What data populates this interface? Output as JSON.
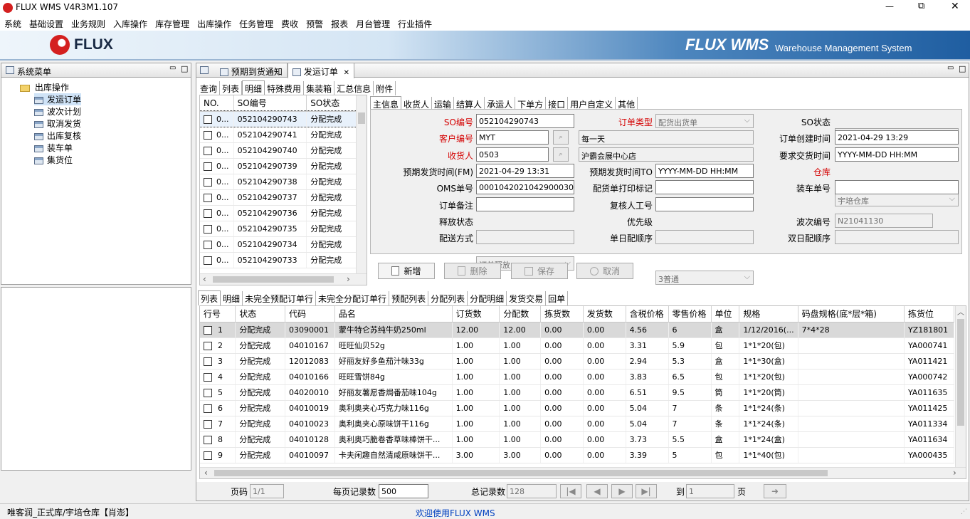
{
  "window": {
    "title": "FLUX WMS V4R3M1.107",
    "controls": [
      "—",
      "⧉",
      "✕"
    ]
  },
  "menu": [
    "系统",
    "基础设置",
    "业务规则",
    "入库操作",
    "库存管理",
    "出库操作",
    "任务管理",
    "费收",
    "预警",
    "报表",
    "月台管理",
    "行业插件"
  ],
  "banner": {
    "logo": "FLUX",
    "right_title": "FLUX WMS",
    "right_sub": "Warehouse Management System"
  },
  "sidebar": {
    "title": "系统菜单",
    "root": "出库操作",
    "items": [
      "发运订单",
      "波次计划",
      "取消发货",
      "出库复核",
      "装车单",
      "集货位"
    ],
    "selected": 0
  },
  "editor_tabs": [
    "预期到货通知",
    "发运订单"
  ],
  "sub_tabs": [
    "查询",
    "列表",
    "明细",
    "特殊费用",
    "集装箱",
    "汇总信息",
    "附件"
  ],
  "so_list": {
    "headers": [
      "NO.",
      "SO编号",
      "SO状态"
    ],
    "rows": [
      [
        "0...",
        "052104290743",
        "分配完成"
      ],
      [
        "0...",
        "052104290741",
        "分配完成"
      ],
      [
        "0...",
        "052104290740",
        "分配完成"
      ],
      [
        "0...",
        "052104290739",
        "分配完成"
      ],
      [
        "0...",
        "052104290738",
        "分配完成"
      ],
      [
        "0...",
        "052104290737",
        "分配完成"
      ],
      [
        "0...",
        "052104290736",
        "分配完成"
      ],
      [
        "0...",
        "052104290735",
        "分配完成"
      ],
      [
        "0...",
        "052104290734",
        "分配完成"
      ],
      [
        "0...",
        "052104290733",
        "分配完成"
      ]
    ]
  },
  "info_tabs": [
    "主信息",
    "收货人",
    "运输",
    "结算人",
    "承运人",
    "下单方",
    "接口",
    "用户自定义",
    "其他"
  ],
  "form": {
    "so_no": {
      "label": "SO编号",
      "value": "052104290743"
    },
    "order_type": {
      "label": "订单类型",
      "value": "配货出货单"
    },
    "so_status": {
      "label": "SO状态",
      "value": "分配完成"
    },
    "customer": {
      "label": "客户编号",
      "value": "MYT",
      "name": "每一天"
    },
    "created": {
      "label": "订单创建时间",
      "value": "2021-04-29 13:29"
    },
    "consignee": {
      "label": "收货人",
      "value": "0503",
      "name": "沪霸会展中心店"
    },
    "req_time": {
      "label": "要求交货时间",
      "value": "YYYY-MM-DD HH:MM"
    },
    "ship_fm": {
      "label": "预期发货时间(FM)",
      "value": "2021-04-29 13:31"
    },
    "ship_to": {
      "label": "预期发货时间TO",
      "value": "YYYY-MM-DD HH:MM"
    },
    "warehouse": {
      "label": "仓库",
      "value": "宇培仓库"
    },
    "oms": {
      "label": "OMS单号",
      "value": "000104202104290003022"
    },
    "print_flag": {
      "label": "配货单打印标记",
      "value": ""
    },
    "load_no": {
      "label": "装车单号",
      "value": ""
    },
    "remark": {
      "label": "订单备注",
      "value": ""
    },
    "reviewer": {
      "label": "复核人工号",
      "value": ""
    },
    "release": {
      "label": "释放状态",
      "value": "订单释放"
    },
    "priority": {
      "label": "优先级",
      "value": "3普通"
    },
    "wave": {
      "label": "波次编号",
      "value": "N21041130"
    },
    "delivery": {
      "label": "配送方式",
      "value": ""
    },
    "single_seq": {
      "label": "单日配顺序",
      "value": ""
    },
    "double_seq": {
      "label": "双日配顺序",
      "value": ""
    }
  },
  "actions": {
    "new": "新增",
    "delete": "删除",
    "save": "保存",
    "cancel": "取消"
  },
  "detail_tabs": [
    "列表",
    "明细",
    "未完全预配订单行",
    "未完全分配订单行",
    "预配列表",
    "分配列表",
    "分配明细",
    "发货交易",
    "回单"
  ],
  "detail": {
    "headers": [
      "行号",
      "状态",
      "代码",
      "品名",
      "订货数",
      "分配数",
      "拣货数",
      "发货数",
      "含税价格",
      "零售价格",
      "单位",
      "规格",
      "码盘规格(底*层*箱)",
      "拣货位"
    ],
    "rows": [
      [
        "1",
        "分配完成",
        "03090001",
        "蒙牛特仑苏纯牛奶250ml",
        "12.00",
        "12.00",
        "0.00",
        "0.00",
        "4.56",
        "6",
        "盒",
        "1/12/2016(...",
        "7*4*28",
        "YZ181801"
      ],
      [
        "2",
        "分配完成",
        "04010167",
        "旺旺仙贝52g",
        "1.00",
        "1.00",
        "0.00",
        "0.00",
        "3.31",
        "5.9",
        "包",
        "1*1*20(包)",
        "",
        "YA000741"
      ],
      [
        "3",
        "分配完成",
        "12012083",
        "好丽友好多鱼茄汁味33g",
        "1.00",
        "1.00",
        "0.00",
        "0.00",
        "2.94",
        "5.3",
        "盒",
        "1*1*30(盒)",
        "",
        "YA011421"
      ],
      [
        "4",
        "分配完成",
        "04010166",
        "旺旺雪饼84g",
        "1.00",
        "1.00",
        "0.00",
        "0.00",
        "3.83",
        "6.5",
        "包",
        "1*1*20(包)",
        "",
        "YA000742"
      ],
      [
        "5",
        "分配完成",
        "04020010",
        "好丽友薯愿香焗番茄味104g",
        "1.00",
        "1.00",
        "0.00",
        "0.00",
        "6.51",
        "9.5",
        "筒",
        "1*1*20(筒)",
        "",
        "YA011635"
      ],
      [
        "6",
        "分配完成",
        "04010019",
        "奥利奥夹心巧克力味116g",
        "1.00",
        "1.00",
        "0.00",
        "0.00",
        "5.04",
        "7",
        "条",
        "1*1*24(条)",
        "",
        "YA011425"
      ],
      [
        "7",
        "分配完成",
        "04010023",
        "奥利奥夹心原味饼干116g",
        "1.00",
        "1.00",
        "0.00",
        "0.00",
        "5.04",
        "7",
        "条",
        "1*1*24(条)",
        "",
        "YA011334"
      ],
      [
        "8",
        "分配完成",
        "04010128",
        "奥利奥巧脆卷香草味棒饼干...",
        "1.00",
        "1.00",
        "0.00",
        "0.00",
        "3.73",
        "5.5",
        "盒",
        "1*1*24(盒)",
        "",
        "YA011634"
      ],
      [
        "9",
        "分配完成",
        "04010097",
        "卡夫闲趣自然清咸原味饼干...",
        "3.00",
        "3.00",
        "0.00",
        "0.00",
        "3.39",
        "5",
        "包",
        "1*1*40(包)",
        "",
        "YA000435"
      ]
    ]
  },
  "pager": {
    "page_label": "页码",
    "page": "1/1",
    "per_label": "每页记录数",
    "per": "500",
    "total_label": "总记录数",
    "total": "128",
    "goto": "到",
    "goto_val": "1",
    "page_suffix": "页"
  },
  "status": {
    "left": "唯客润_正式库/宇培仓库【肖澎】",
    "center": "欢迎使用FLUX WMS"
  }
}
